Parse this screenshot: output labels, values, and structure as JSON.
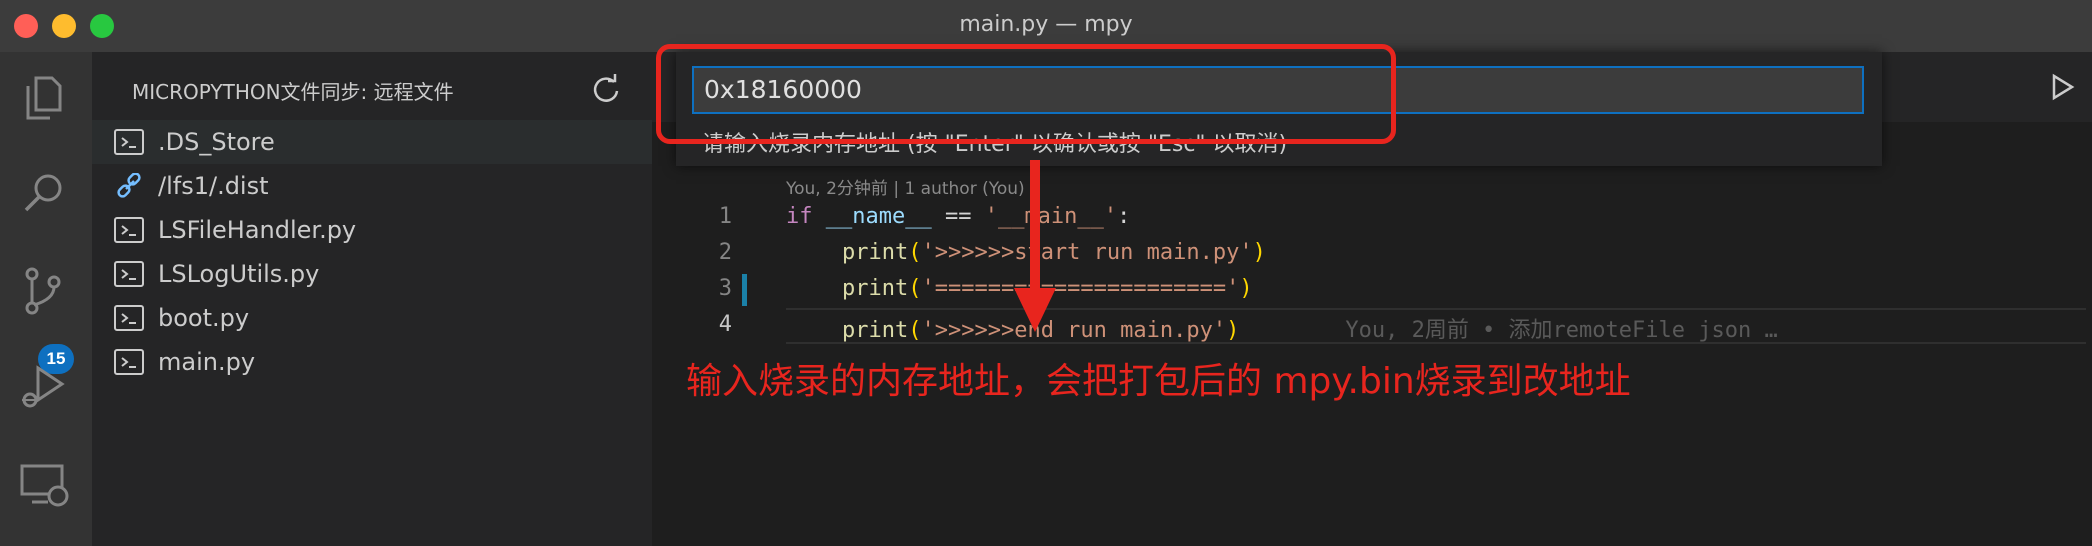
{
  "window": {
    "title": "main.py — mpy",
    "traffic_lights": {
      "close": "#ff5f57",
      "minimize": "#febc2e",
      "zoom": "#28c840"
    }
  },
  "activity_bar": {
    "items": [
      {
        "icon": "files-icon"
      },
      {
        "icon": "search-icon"
      },
      {
        "icon": "source-control-icon",
        "badge": "15"
      },
      {
        "icon": "run-debug-icon"
      },
      {
        "icon": "remote-explorer-icon"
      }
    ]
  },
  "sidebar": {
    "title": "MICROPYTHON文件同步: 远程文件",
    "refresh_icon": "refresh-icon",
    "files": [
      {
        "name": ".DS_Store",
        "icon": "file-terminal-icon"
      },
      {
        "name": "/lfs1/.dist",
        "icon": "link-icon"
      },
      {
        "name": "LSFileHandler.py",
        "icon": "file-terminal-icon"
      },
      {
        "name": "LSLogUtils.py",
        "icon": "file-terminal-icon"
      },
      {
        "name": "boot.py",
        "icon": "file-terminal-icon"
      },
      {
        "name": "main.py",
        "icon": "file-terminal-icon"
      }
    ]
  },
  "quick_input": {
    "value": "0x18160000",
    "hint": "请输入烧录内存地址 (按 \"Enter\" 以确认或按 \"Esc\" 以取消)"
  },
  "editor": {
    "run_icon": "run-icon",
    "blame_header": "You, 2分钟前 | 1 author (You)",
    "lines": [
      {
        "n": "1",
        "t1": "if",
        "t2": " ",
        "t3": "__name__",
        "t4": " == ",
        "t5": "'__main__'",
        "t6": ":"
      },
      {
        "n": "2",
        "fn": "print",
        "open": "(",
        "str": "'>>>>>>start run main.py'",
        "close": ")"
      },
      {
        "n": "3",
        "fn": "print",
        "open": "(",
        "str": "'======================'",
        "close": ")"
      },
      {
        "n": "4",
        "fn": "print",
        "open": "(",
        "str": "'>>>>>>end run main.py'",
        "close": ")",
        "inline_blame": "You, 2周前 • 添加remoteFile json …"
      }
    ]
  },
  "annotation": {
    "text": "输入烧录的内存地址，会把打包后的 mpy.bin烧录到改地址",
    "color": "#e8251e"
  }
}
